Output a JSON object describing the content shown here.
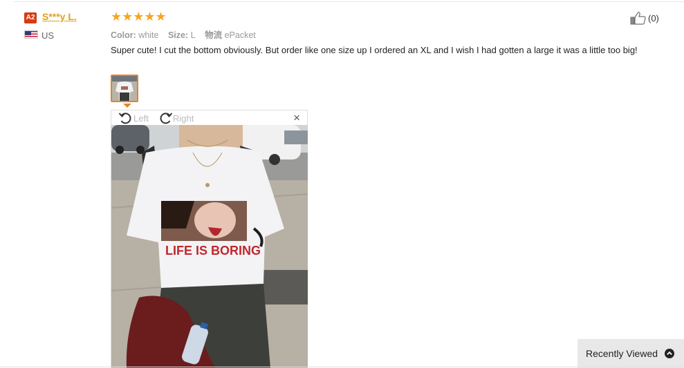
{
  "reviewer": {
    "level_badge": "A2",
    "name": "S***y L.",
    "country": "US"
  },
  "rating": {
    "stars": 5,
    "stars_text": "★★★★★"
  },
  "properties": [
    {
      "key": "Color:",
      "value": "white"
    },
    {
      "key": "Size:",
      "value": "L"
    },
    {
      "key": "物流",
      "value": "ePacket"
    }
  ],
  "helpful": {
    "count": "(0)"
  },
  "review_text": "Super cute! I cut the bottom obviously. But order like one size up I ordered an XL and I wish I had gotten a large it was a little too big!",
  "viewer": {
    "rotate_left_label": "Left",
    "rotate_right_label": "Right",
    "close_label": "×",
    "shirt_print_text": "LIFE IS BORING"
  },
  "recently_viewed": {
    "label": "Recently Viewed"
  },
  "colors": {
    "badge": "#d63b12",
    "username": "#e0a11d",
    "stars": "#f5a623",
    "thumb_border": "#e0852b"
  }
}
